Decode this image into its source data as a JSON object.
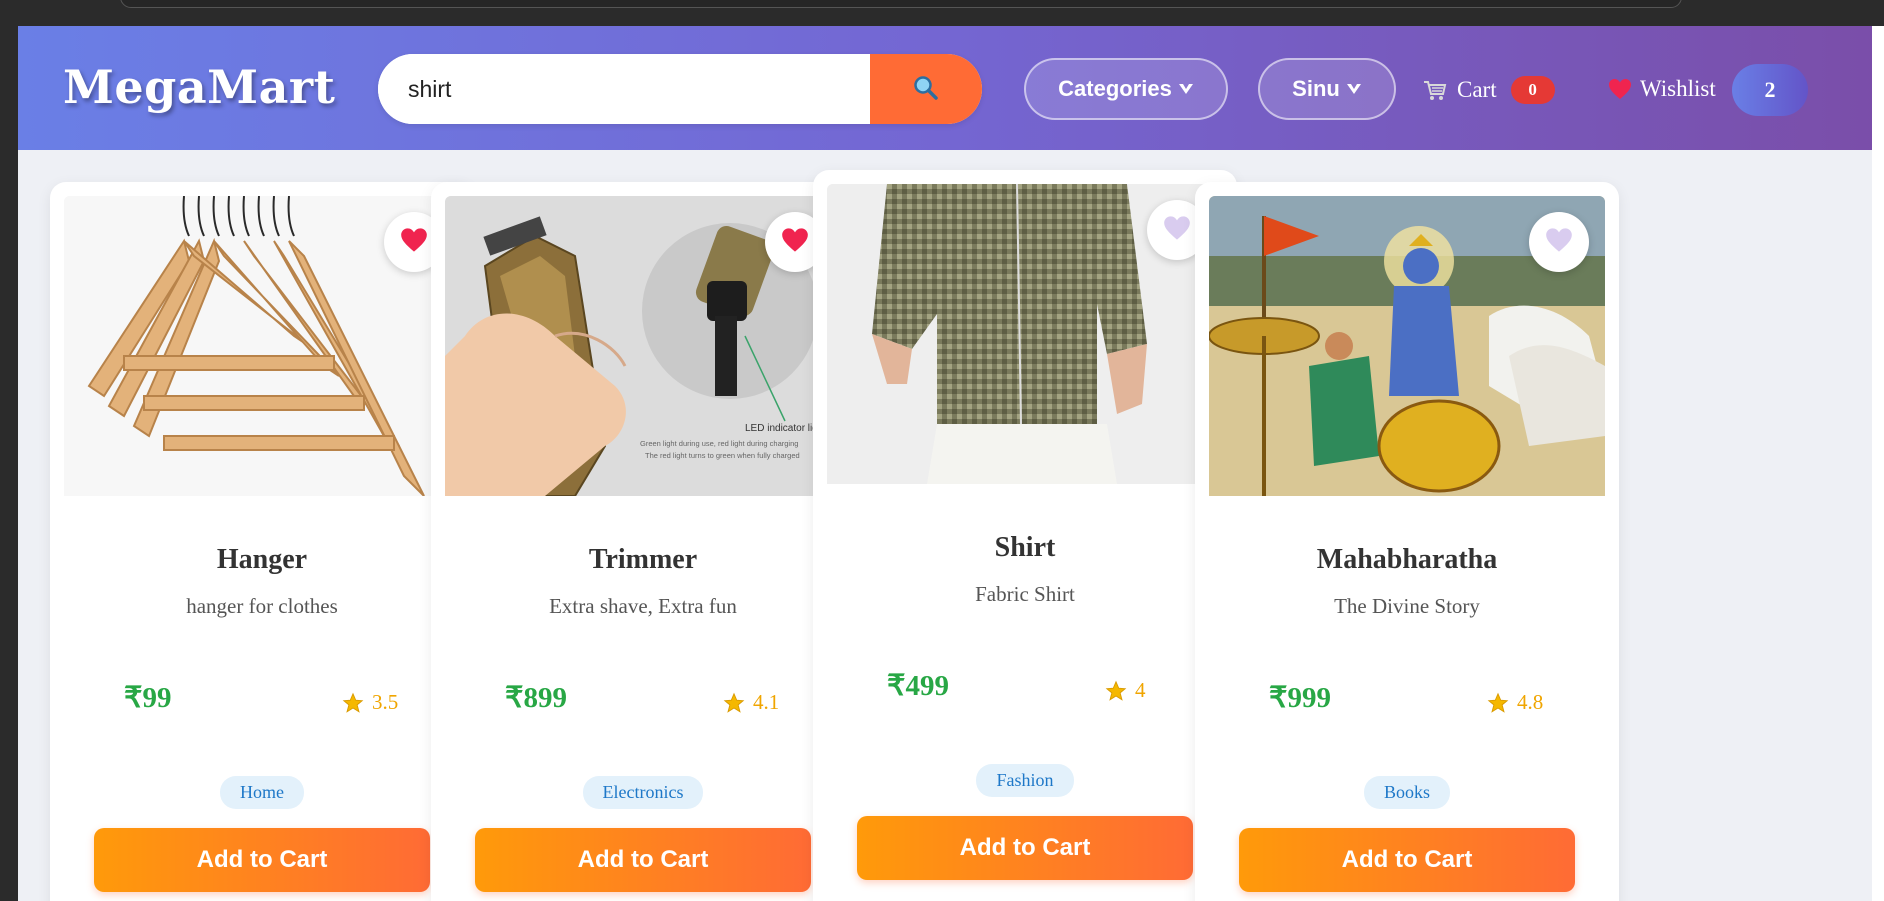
{
  "header": {
    "brand": "MegaMart",
    "search": {
      "value": "shirt"
    },
    "categories_label": "Categories",
    "user_label": "Sinu",
    "cart_label": "Cart",
    "cart_count": "0",
    "wishlist_label": "Wishlist",
    "wishlist_count": "2"
  },
  "products": [
    {
      "title": "Hanger",
      "description": "hanger for clothes",
      "price": "₹99",
      "rating": "3.5",
      "category": "Home",
      "button": "Add to Cart",
      "wishlisted": true
    },
    {
      "title": "Trimmer",
      "description": "Extra shave, Extra fun",
      "price": "₹899",
      "rating": "4.1",
      "category": "Electronics",
      "button": "Add to Cart",
      "wishlisted": true,
      "image_text": {
        "line1": "LED indicator light",
        "line2": "Green light during use, red light during charging",
        "line3": "The red light turns to green when fully charged"
      }
    },
    {
      "title": "Shirt",
      "description": "Fabric Shirt",
      "price": "₹499",
      "rating": "4",
      "category": "Fashion",
      "button": "Add to Cart",
      "wishlisted": false
    },
    {
      "title": "Mahabharatha",
      "description": "The Divine Story",
      "price": "₹999",
      "rating": "4.8",
      "category": "Books",
      "button": "Add to Cart",
      "wishlisted": false
    }
  ],
  "colors": {
    "accent_orange": "#ff6b35",
    "price_green": "#28a745",
    "header_start": "#6a7fe6",
    "header_end": "#7a4ea9",
    "wishlist_heart": "#f0244f",
    "unwishlist_heart": "#d9ccef"
  },
  "icons": [
    "search-icon",
    "chevron-down-icon",
    "cart-icon",
    "heart-icon",
    "star-icon"
  ]
}
